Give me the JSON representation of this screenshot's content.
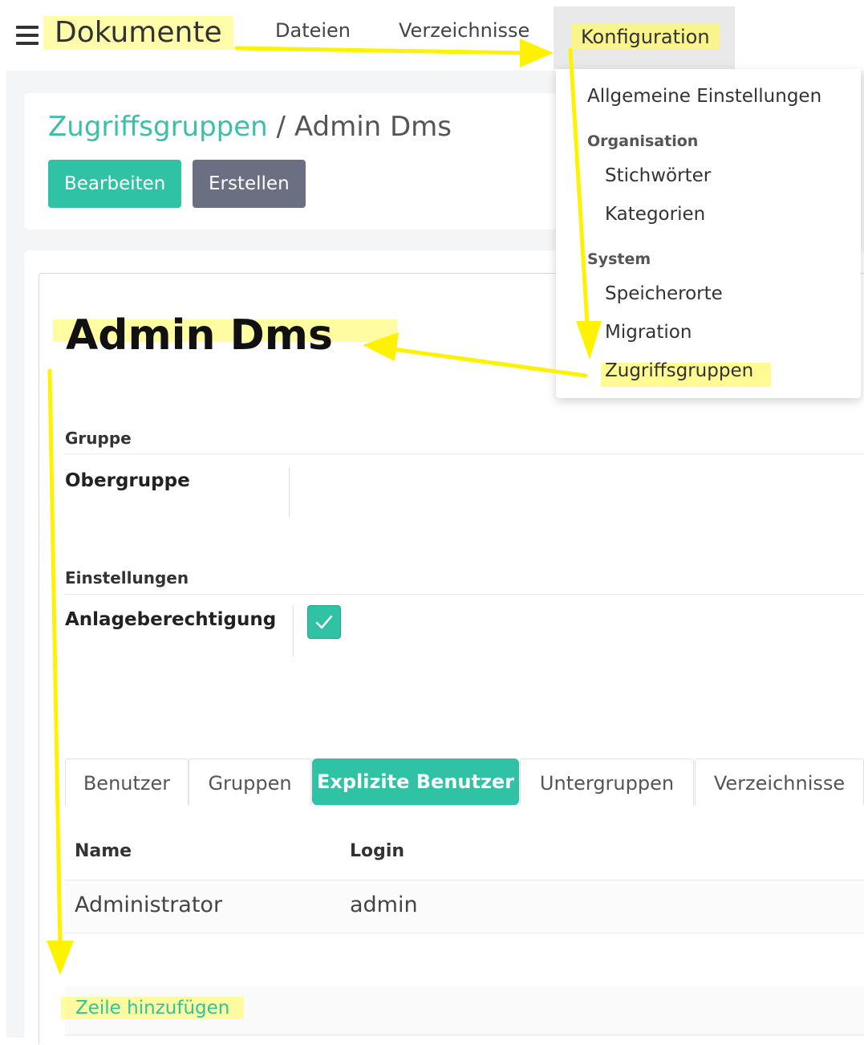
{
  "topbar": {
    "brand": "Dokumente",
    "nav": [
      "Dateien",
      "Verzeichnisse",
      "Konfiguration"
    ]
  },
  "header": {
    "breadcrumb_link": "Zugriffsgruppen",
    "breadcrumb_sep": "/",
    "breadcrumb_current": "Admin Dms",
    "edit_label": "Bearbeiten",
    "create_label": "Erstellen"
  },
  "form": {
    "title": "Admin Dms",
    "section_group": "Gruppe",
    "field_parent": "Obergruppe",
    "section_settings": "Einstellungen",
    "field_create_permission": "Anlageberechtigung",
    "create_permission_checked": true
  },
  "tabs": [
    "Benutzer",
    "Gruppen",
    "Explizite Benutzer",
    "Untergruppen",
    "Verzeichnisse"
  ],
  "active_tab": "Explizite Benutzer",
  "table": {
    "columns": [
      "Name",
      "Login"
    ],
    "rows": [
      {
        "name": "Administrator",
        "login": "admin"
      }
    ],
    "add_row": "Zeile hinzufügen"
  },
  "dropdown": {
    "general": "Allgemeine Einstellungen",
    "section_org": "Organisation",
    "org_items": [
      "Stichwörter",
      "Kategorien"
    ],
    "section_system": "System",
    "system_items": [
      "Speicherorte",
      "Migration",
      "Zugriffsgruppen"
    ]
  },
  "colors": {
    "accent": "#2fc2a4",
    "link": "#3cbfa9",
    "secondary_button": "#6b6f82",
    "annotation": "#fff200"
  },
  "icons": {
    "menu": "hamburger-icon",
    "check": "check-icon"
  }
}
